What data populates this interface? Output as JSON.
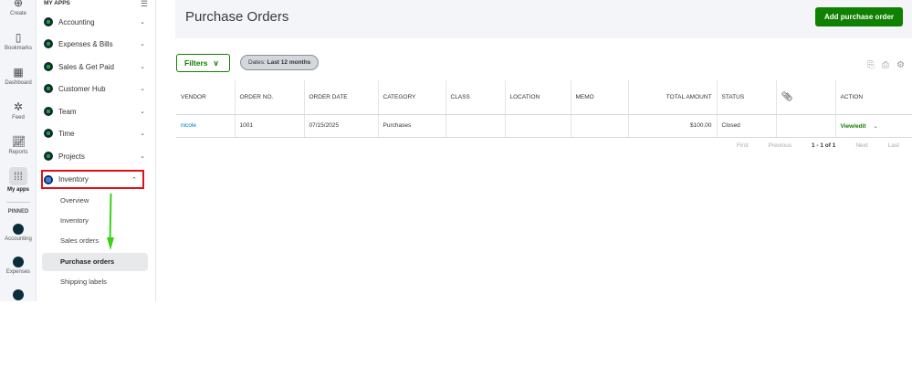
{
  "rail": {
    "items": [
      {
        "label": "Create",
        "icon": "plus-circle-icon"
      },
      {
        "label": "Bookmarks",
        "icon": "bookmark-icon"
      },
      {
        "label": "Dashboard",
        "icon": "dashboard-icon"
      },
      {
        "label": "Feed",
        "icon": "feed-icon"
      },
      {
        "label": "Reports",
        "icon": "chart-icon"
      },
      {
        "label": "My apps",
        "icon": "grid-icon"
      }
    ],
    "pinned_label": "PINNED",
    "pinned": [
      {
        "label": "Accounting"
      },
      {
        "label": "Expenses"
      }
    ]
  },
  "nav": {
    "header": "MY APPS",
    "apps": [
      {
        "label": "Accounting"
      },
      {
        "label": "Expenses & Bills"
      },
      {
        "label": "Sales & Get Paid"
      },
      {
        "label": "Customer Hub"
      },
      {
        "label": "Team"
      },
      {
        "label": "Time"
      },
      {
        "label": "Projects"
      },
      {
        "label": "Inventory"
      }
    ],
    "sub": [
      {
        "label": "Overview"
      },
      {
        "label": "Inventory"
      },
      {
        "label": "Sales orders"
      },
      {
        "label": "Purchase orders"
      },
      {
        "label": "Shipping labels"
      }
    ]
  },
  "page": {
    "title": "Purchase Orders",
    "add_button": "Add purchase order",
    "filters": "Filters",
    "date_chip_label": "Dates:",
    "date_chip_value": "Last 12 months"
  },
  "table": {
    "columns": [
      "VENDOR",
      "ORDER NO.",
      "ORDER DATE",
      "CATEGORY",
      "CLASS",
      "LOCATION",
      "MEMO",
      "TOTAL AMOUNT",
      "STATUS",
      "",
      "ACTION"
    ],
    "rows": [
      {
        "vendor": "nicole",
        "order_no": "1001",
        "order_date": "07/15/2025",
        "category": "Purchases",
        "class": "",
        "location": "",
        "memo": "",
        "total": "$100.00",
        "status": "Closed",
        "action": "View/edit"
      }
    ]
  },
  "pager": {
    "first": "First",
    "previous": "Previous",
    "range": "1 - 1 of 1",
    "next": "Next",
    "last": "Last"
  },
  "colors": {
    "brand": "#108000",
    "highlight": "#e0101a",
    "arrow": "#3cd01a"
  }
}
